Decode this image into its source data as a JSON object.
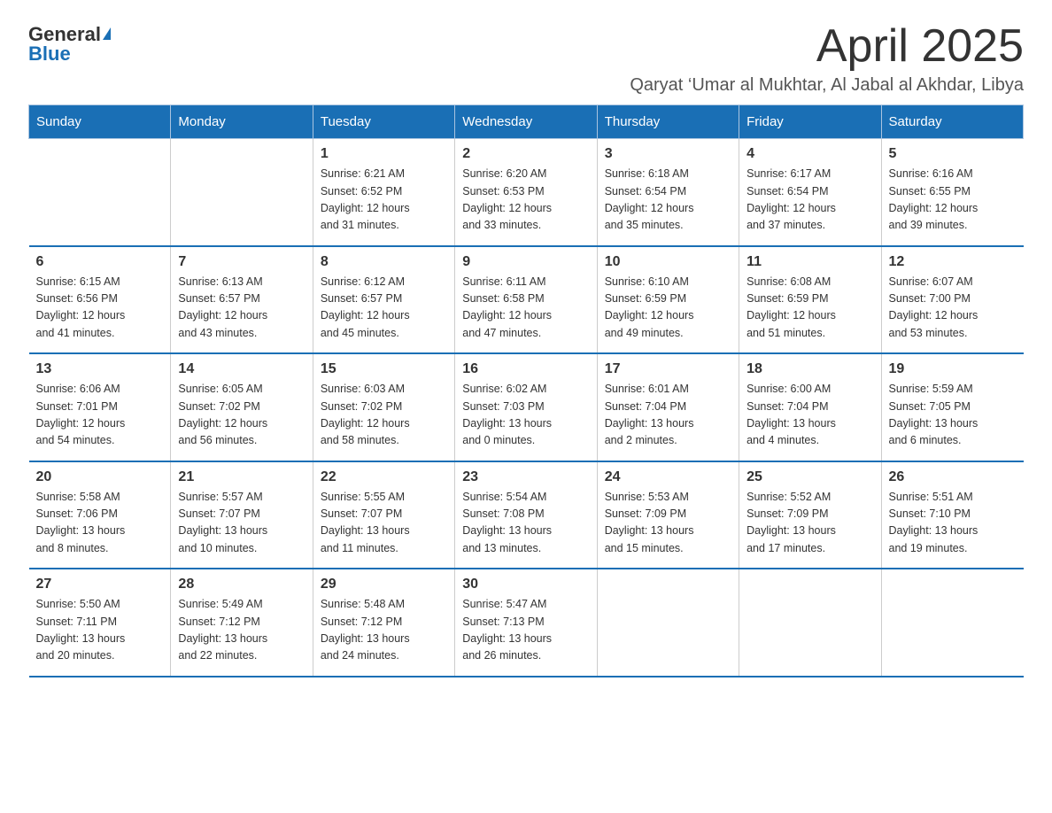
{
  "logo": {
    "general": "General",
    "blue": "Blue",
    "triangle": true
  },
  "title": "April 2025",
  "subtitle": "Qaryat ‘Umar al Mukhtar, Al Jabal al Akhdar, Libya",
  "weekdays": [
    "Sunday",
    "Monday",
    "Tuesday",
    "Wednesday",
    "Thursday",
    "Friday",
    "Saturday"
  ],
  "weeks": [
    [
      {
        "day": "",
        "info": ""
      },
      {
        "day": "",
        "info": ""
      },
      {
        "day": "1",
        "info": "Sunrise: 6:21 AM\nSunset: 6:52 PM\nDaylight: 12 hours\nand 31 minutes."
      },
      {
        "day": "2",
        "info": "Sunrise: 6:20 AM\nSunset: 6:53 PM\nDaylight: 12 hours\nand 33 minutes."
      },
      {
        "day": "3",
        "info": "Sunrise: 6:18 AM\nSunset: 6:54 PM\nDaylight: 12 hours\nand 35 minutes."
      },
      {
        "day": "4",
        "info": "Sunrise: 6:17 AM\nSunset: 6:54 PM\nDaylight: 12 hours\nand 37 minutes."
      },
      {
        "day": "5",
        "info": "Sunrise: 6:16 AM\nSunset: 6:55 PM\nDaylight: 12 hours\nand 39 minutes."
      }
    ],
    [
      {
        "day": "6",
        "info": "Sunrise: 6:15 AM\nSunset: 6:56 PM\nDaylight: 12 hours\nand 41 minutes."
      },
      {
        "day": "7",
        "info": "Sunrise: 6:13 AM\nSunset: 6:57 PM\nDaylight: 12 hours\nand 43 minutes."
      },
      {
        "day": "8",
        "info": "Sunrise: 6:12 AM\nSunset: 6:57 PM\nDaylight: 12 hours\nand 45 minutes."
      },
      {
        "day": "9",
        "info": "Sunrise: 6:11 AM\nSunset: 6:58 PM\nDaylight: 12 hours\nand 47 minutes."
      },
      {
        "day": "10",
        "info": "Sunrise: 6:10 AM\nSunset: 6:59 PM\nDaylight: 12 hours\nand 49 minutes."
      },
      {
        "day": "11",
        "info": "Sunrise: 6:08 AM\nSunset: 6:59 PM\nDaylight: 12 hours\nand 51 minutes."
      },
      {
        "day": "12",
        "info": "Sunrise: 6:07 AM\nSunset: 7:00 PM\nDaylight: 12 hours\nand 53 minutes."
      }
    ],
    [
      {
        "day": "13",
        "info": "Sunrise: 6:06 AM\nSunset: 7:01 PM\nDaylight: 12 hours\nand 54 minutes."
      },
      {
        "day": "14",
        "info": "Sunrise: 6:05 AM\nSunset: 7:02 PM\nDaylight: 12 hours\nand 56 minutes."
      },
      {
        "day": "15",
        "info": "Sunrise: 6:03 AM\nSunset: 7:02 PM\nDaylight: 12 hours\nand 58 minutes."
      },
      {
        "day": "16",
        "info": "Sunrise: 6:02 AM\nSunset: 7:03 PM\nDaylight: 13 hours\nand 0 minutes."
      },
      {
        "day": "17",
        "info": "Sunrise: 6:01 AM\nSunset: 7:04 PM\nDaylight: 13 hours\nand 2 minutes."
      },
      {
        "day": "18",
        "info": "Sunrise: 6:00 AM\nSunset: 7:04 PM\nDaylight: 13 hours\nand 4 minutes."
      },
      {
        "day": "19",
        "info": "Sunrise: 5:59 AM\nSunset: 7:05 PM\nDaylight: 13 hours\nand 6 minutes."
      }
    ],
    [
      {
        "day": "20",
        "info": "Sunrise: 5:58 AM\nSunset: 7:06 PM\nDaylight: 13 hours\nand 8 minutes."
      },
      {
        "day": "21",
        "info": "Sunrise: 5:57 AM\nSunset: 7:07 PM\nDaylight: 13 hours\nand 10 minutes."
      },
      {
        "day": "22",
        "info": "Sunrise: 5:55 AM\nSunset: 7:07 PM\nDaylight: 13 hours\nand 11 minutes."
      },
      {
        "day": "23",
        "info": "Sunrise: 5:54 AM\nSunset: 7:08 PM\nDaylight: 13 hours\nand 13 minutes."
      },
      {
        "day": "24",
        "info": "Sunrise: 5:53 AM\nSunset: 7:09 PM\nDaylight: 13 hours\nand 15 minutes."
      },
      {
        "day": "25",
        "info": "Sunrise: 5:52 AM\nSunset: 7:09 PM\nDaylight: 13 hours\nand 17 minutes."
      },
      {
        "day": "26",
        "info": "Sunrise: 5:51 AM\nSunset: 7:10 PM\nDaylight: 13 hours\nand 19 minutes."
      }
    ],
    [
      {
        "day": "27",
        "info": "Sunrise: 5:50 AM\nSunset: 7:11 PM\nDaylight: 13 hours\nand 20 minutes."
      },
      {
        "day": "28",
        "info": "Sunrise: 5:49 AM\nSunset: 7:12 PM\nDaylight: 13 hours\nand 22 minutes."
      },
      {
        "day": "29",
        "info": "Sunrise: 5:48 AM\nSunset: 7:12 PM\nDaylight: 13 hours\nand 24 minutes."
      },
      {
        "day": "30",
        "info": "Sunrise: 5:47 AM\nSunset: 7:13 PM\nDaylight: 13 hours\nand 26 minutes."
      },
      {
        "day": "",
        "info": ""
      },
      {
        "day": "",
        "info": ""
      },
      {
        "day": "",
        "info": ""
      }
    ]
  ]
}
